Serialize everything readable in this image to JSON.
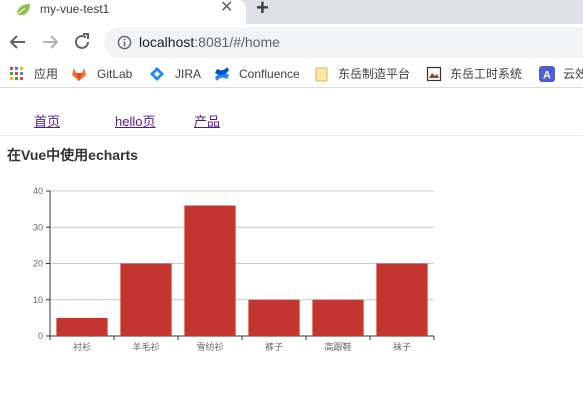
{
  "browser": {
    "tab_title": "my-vue-test1",
    "tab_close_glyph": "✕",
    "new_tab_glyph": "+",
    "url_host": "localhost",
    "url_rest": ":8081/#/home",
    "bookmarks": [
      {
        "label": "应用",
        "icon": "apps-grid-icon"
      },
      {
        "label": "GitLab",
        "icon": "gitlab-icon"
      },
      {
        "label": "JIRA",
        "icon": "jira-icon"
      },
      {
        "label": "Confluence",
        "icon": "confluence-icon"
      },
      {
        "label": "东岳制造平台",
        "icon": "folder-icon"
      },
      {
        "label": "东岳工时系统",
        "icon": "image-icon"
      },
      {
        "label": "云效",
        "icon": "letter-a-icon"
      }
    ]
  },
  "page": {
    "nav": [
      {
        "label": "首页"
      },
      {
        "label": "hello页"
      },
      {
        "label": "产品"
      }
    ],
    "title": "在Vue中使用echarts"
  },
  "colors": {
    "bar": "#c23531",
    "axis": "#333333",
    "grid": "#cccccc"
  },
  "chart_data": {
    "type": "bar",
    "categories": [
      "衬衫",
      "羊毛衫",
      "雪纺衫",
      "裤子",
      "高跟鞋",
      "袜子"
    ],
    "values": [
      5,
      20,
      36,
      10,
      10,
      20
    ],
    "ylim": [
      0,
      40
    ],
    "yticks": [
      0,
      10,
      20,
      30,
      40
    ],
    "grid": true,
    "title": "",
    "xlabel": "",
    "ylabel": ""
  }
}
